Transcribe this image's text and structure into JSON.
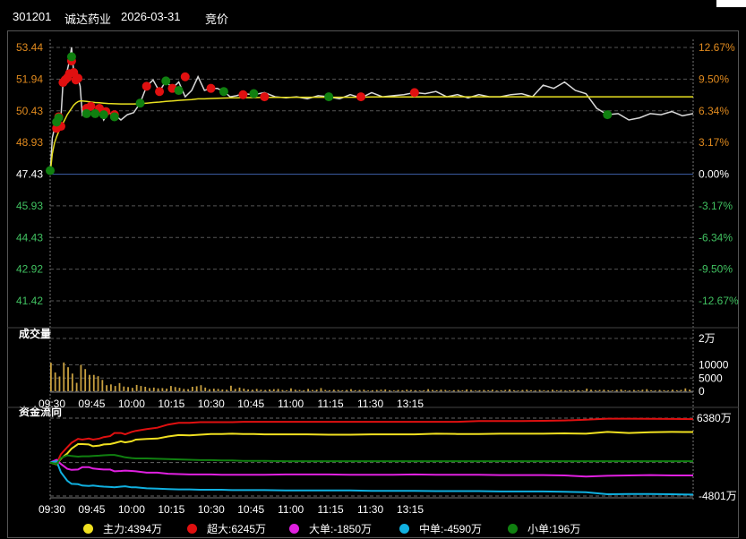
{
  "header": {
    "code": "301201",
    "name": "诚达药业",
    "date": "2026-03-31",
    "mode": "竞价"
  },
  "colors": {
    "up": "#e08a1e",
    "down": "#40c060",
    "price_line": "#d8d8d8",
    "avg_line": "#e8e020",
    "buy_dot": "#e01010",
    "sell_dot": "#108010",
    "volume": "#c8a040",
    "zero_line": "#3a5aa0"
  },
  "chart_data": [
    {
      "type": "line",
      "panel": "price",
      "title": "",
      "base_price": 47.43,
      "ylim": [
        41.42,
        53.44
      ],
      "left_ticks": [
        "53.44",
        "51.94",
        "50.43",
        "48.93",
        "47.43",
        "45.93",
        "44.43",
        "42.92",
        "41.42"
      ],
      "right_ticks": [
        "12.67%",
        "9.50%",
        "6.34%",
        "3.17%",
        "0.00%",
        "-3.17%",
        "-6.34%",
        "-9.50%",
        "-12.67%"
      ],
      "x_minutes": [
        0,
        1,
        2,
        3,
        4,
        5,
        6,
        7,
        8,
        9,
        10,
        11,
        12,
        13,
        14,
        15,
        17,
        19,
        21,
        23,
        25,
        27,
        30,
        33,
        36,
        39,
        42,
        45,
        48,
        51,
        54,
        57,
        60,
        63,
        66,
        69,
        72,
        75,
        78,
        81,
        84,
        87,
        90,
        95,
        100,
        105,
        110,
        115,
        120,
        125,
        130,
        135,
        140,
        145,
        150,
        155,
        160,
        165,
        170,
        175,
        180,
        185,
        190,
        195,
        200,
        205,
        210,
        215,
        220,
        225,
        230,
        235,
        240,
        245,
        250,
        255,
        260,
        265,
        270,
        275,
        280,
        285,
        290,
        295,
        300
      ],
      "series": [
        {
          "values": [
            47.43,
            49.15,
            49.6,
            49.7,
            50.15,
            50.1,
            51.78,
            51.9,
            52.35,
            52.8,
            53.44,
            52.25,
            51.9,
            51.98,
            51.6,
            50.25,
            50.55,
            50.65,
            50.3,
            50.55,
            50.0,
            50.35,
            50.25,
            50.0,
            50.25,
            50.35,
            50.8,
            51.6,
            51.9,
            51.35,
            51.85,
            51.5,
            51.8,
            51.1,
            51.4,
            52.05,
            51.4,
            51.5,
            51.5,
            51.35,
            51.1,
            51.15,
            51.25,
            51.2,
            51.3,
            51.1,
            51.05,
            51.1,
            51.0,
            51.15,
            51.1,
            51.0,
            51.2,
            51.05,
            51.3,
            51.1,
            51.15,
            51.2,
            51.3,
            51.25,
            51.35,
            51.1,
            51.2,
            51.05,
            51.2,
            51.1,
            51.1,
            51.2,
            51.25,
            51.1,
            51.65,
            51.5,
            51.8,
            51.4,
            51.25,
            50.55,
            50.25,
            50.3,
            50.0,
            50.1,
            50.3,
            50.25,
            50.4,
            50.2,
            50.3
          ]
        },
        {
          "values": [
            47.43,
            48.4,
            48.9,
            49.2,
            49.45,
            49.65,
            49.85,
            50.05,
            50.25,
            50.4,
            50.55,
            50.7,
            50.8,
            50.87,
            50.9,
            50.9,
            50.88,
            50.85,
            50.83,
            50.82,
            50.8,
            50.78,
            50.77,
            50.76,
            50.76,
            50.76,
            50.77,
            50.8,
            50.83,
            50.85,
            50.88,
            50.9,
            50.93,
            50.95,
            50.97,
            51.0,
            51.0,
            51.02,
            51.03,
            51.04,
            51.05,
            51.05,
            51.06,
            51.06,
            51.07,
            51.07,
            51.07,
            51.08,
            51.08,
            51.08,
            51.08,
            51.08,
            51.08,
            51.08,
            51.09,
            51.09,
            51.09,
            51.09,
            51.09,
            51.1,
            51.1,
            51.1,
            51.1,
            51.1,
            51.1,
            51.1,
            51.1,
            51.1,
            51.1,
            51.1,
            51.1,
            51.1,
            51.1,
            51.1,
            51.1,
            51.1,
            51.1,
            51.1,
            51.1,
            51.1,
            51.1,
            51.1,
            51.1,
            51.1,
            51.1
          ]
        }
      ],
      "buy_points": [
        [
          3,
          49.6
        ],
        [
          4,
          50.15
        ],
        [
          5,
          49.7
        ],
        [
          6,
          51.78
        ],
        [
          7,
          51.9
        ],
        [
          8,
          52.0
        ],
        [
          9,
          52.2
        ],
        [
          10,
          52.8
        ],
        [
          11,
          52.25
        ],
        [
          12,
          51.9
        ],
        [
          13,
          51.98
        ],
        [
          17,
          50.55
        ],
        [
          19,
          50.65
        ],
        [
          23,
          50.55
        ],
        [
          26,
          50.4
        ],
        [
          30,
          50.25
        ],
        [
          45,
          51.6
        ],
        [
          51,
          51.35
        ],
        [
          57,
          51.5
        ],
        [
          63,
          52.05
        ],
        [
          75,
          51.5
        ],
        [
          90,
          51.2
        ],
        [
          100,
          51.1
        ],
        [
          145,
          51.1
        ],
        [
          170,
          51.3
        ]
      ],
      "sell_points": [
        [
          0,
          47.6
        ],
        [
          3,
          49.9
        ],
        [
          4,
          50.1
        ],
        [
          10,
          53.0
        ],
        [
          17,
          50.3
        ],
        [
          21,
          50.3
        ],
        [
          25,
          50.25
        ],
        [
          30,
          50.15
        ],
        [
          42,
          50.8
        ],
        [
          54,
          51.85
        ],
        [
          60,
          51.4
        ],
        [
          81,
          51.35
        ],
        [
          95,
          51.25
        ],
        [
          130,
          51.1
        ],
        [
          260,
          50.25
        ]
      ]
    },
    {
      "type": "bar",
      "panel": "volume",
      "title": "成交量",
      "yticks": [
        "2万",
        "10000",
        "5000",
        "0"
      ],
      "ylim": [
        0,
        20000
      ],
      "x_minutes": [
        0,
        2,
        4,
        6,
        8,
        10,
        12,
        14,
        16,
        18,
        20,
        22,
        24,
        26,
        28,
        30,
        32,
        34,
        36,
        38,
        40,
        42,
        44,
        46,
        48,
        50,
        52,
        54,
        56,
        58,
        60,
        62,
        64,
        66,
        68,
        70,
        72,
        74,
        76,
        78,
        80,
        82,
        84,
        86,
        88,
        90,
        92,
        94,
        96,
        98,
        100,
        102,
        104,
        106,
        108,
        110,
        112,
        114,
        116,
        118,
        120,
        122,
        124,
        126,
        128,
        130,
        132,
        134,
        136,
        138,
        140,
        142,
        144,
        146,
        148,
        150,
        152,
        154,
        156,
        158,
        160,
        162,
        164,
        166,
        168,
        170,
        172,
        174,
        176,
        178,
        180,
        182,
        184,
        186,
        188,
        190,
        192,
        194,
        196,
        198,
        200,
        202,
        204,
        206,
        208,
        210,
        212,
        214,
        216,
        218,
        220,
        222,
        224,
        226,
        228,
        230,
        232,
        234,
        236,
        238,
        240,
        242,
        244,
        246,
        248,
        250,
        252,
        254,
        256,
        258,
        260,
        262,
        264,
        266,
        268,
        270,
        272,
        274,
        276,
        278,
        280,
        282,
        284,
        286,
        288,
        290,
        292,
        294,
        296,
        298,
        300
      ],
      "values": [
        10800,
        7100,
        5600,
        10900,
        9100,
        6700,
        3200,
        10000,
        8400,
        6200,
        6200,
        5700,
        4300,
        2300,
        2600,
        2000,
        3100,
        1800,
        1600,
        1300,
        2400,
        2000,
        1700,
        1200,
        1400,
        1100,
        1200,
        1000,
        2000,
        1600,
        1300,
        900,
        800,
        1700,
        1900,
        2300,
        1400,
        800,
        1000,
        900,
        700,
        600,
        2100,
        900,
        1400,
        1000,
        700,
        600,
        900,
        600,
        500,
        700,
        800,
        900,
        500,
        400,
        1100,
        600,
        500,
        400,
        900,
        500,
        600,
        1200,
        500,
        400,
        600,
        500,
        400,
        500,
        800,
        400,
        500,
        600,
        300,
        400,
        500,
        600,
        700,
        400,
        300,
        500,
        400,
        600,
        500,
        400,
        300,
        400,
        800,
        500,
        400,
        600,
        500,
        300,
        400,
        500,
        400,
        700,
        500,
        300,
        400,
        500,
        400,
        600,
        300,
        400,
        500,
        700,
        400,
        300,
        500,
        600,
        400,
        300,
        500,
        400,
        300,
        600,
        400,
        500,
        300,
        400,
        500,
        400,
        300,
        1000,
        600,
        400,
        500,
        600,
        400,
        300,
        500,
        700,
        400,
        300,
        500,
        400,
        600,
        800,
        400,
        300,
        500,
        400,
        300,
        600,
        400,
        500,
        1100,
        600
      ]
    },
    {
      "type": "line",
      "panel": "fund_flow",
      "title": "资金流向",
      "yticks": [
        "6380万",
        "-4801万"
      ],
      "ylim": [
        -4801,
        6380
      ],
      "x_minutes": [
        0,
        3,
        5,
        8,
        10,
        13,
        15,
        18,
        20,
        23,
        25,
        28,
        30,
        33,
        35,
        38,
        40,
        45,
        50,
        55,
        60,
        65,
        70,
        75,
        80,
        85,
        90,
        95,
        100,
        110,
        120,
        130,
        140,
        150,
        160,
        170,
        180,
        190,
        200,
        210,
        220,
        230,
        240,
        250,
        260,
        270,
        280,
        290,
        300
      ],
      "series": [
        {
          "name": "主力",
          "color": "#f0e020",
          "values": [
            0,
            -250,
            550,
            1300,
            2000,
            2650,
            2650,
            2600,
            2350,
            2450,
            2600,
            2650,
            2800,
            3050,
            2900,
            3050,
            3300,
            3400,
            3450,
            3750,
            3950,
            3900,
            4000,
            4100,
            4100,
            4150,
            4100,
            4100,
            4050,
            4050,
            4050,
            4000,
            4000,
            4050,
            4050,
            4050,
            4150,
            4100,
            4100,
            4150,
            4150,
            4150,
            4200,
            4150,
            4400,
            4250,
            4350,
            4400,
            4394
          ]
        },
        {
          "name": "超大",
          "color": "#e01010",
          "values": [
            0,
            -100,
            1200,
            2200,
            2850,
            3400,
            3300,
            3450,
            3300,
            3450,
            3650,
            3800,
            4250,
            4250,
            4050,
            4400,
            4550,
            4800,
            5000,
            5450,
            5700,
            5700,
            5800,
            5800,
            5800,
            5800,
            5850,
            5850,
            5850,
            5850,
            5850,
            5850,
            5850,
            5850,
            5850,
            5850,
            5850,
            5850,
            5950,
            5950,
            5950,
            6000,
            6050,
            6150,
            6300,
            6300,
            6280,
            6260,
            6245
          ]
        },
        {
          "name": "大单",
          "color": "#e020e0",
          "values": [
            0,
            400,
            -200,
            -900,
            -1050,
            -1000,
            -650,
            -650,
            -850,
            -950,
            -1000,
            -1000,
            -1250,
            -1200,
            -1150,
            -1200,
            -1250,
            -1450,
            -1450,
            -1600,
            -1650,
            -1700,
            -1700,
            -1700,
            -1750,
            -1750,
            -1750,
            -1750,
            -1750,
            -1700,
            -1700,
            -1700,
            -1750,
            -1750,
            -1750,
            -1700,
            -1750,
            -1750,
            -1750,
            -1800,
            -1800,
            -1800,
            -1850,
            -2000,
            -1900,
            -1850,
            -1800,
            -1850,
            -1850
          ]
        },
        {
          "name": "中单",
          "color": "#10b0e0",
          "values": [
            0,
            200,
            -1400,
            -2600,
            -3050,
            -3100,
            -3300,
            -3350,
            -3300,
            -3400,
            -3450,
            -3500,
            -3550,
            -3450,
            -3400,
            -3550,
            -3550,
            -3700,
            -3750,
            -3800,
            -3850,
            -3850,
            -3900,
            -3900,
            -3900,
            -3950,
            -3950,
            -3950,
            -3950,
            -4000,
            -4000,
            -4000,
            -4000,
            -4050,
            -4050,
            -4050,
            -4100,
            -4100,
            -4100,
            -4150,
            -4150,
            -4150,
            -4200,
            -4250,
            -4550,
            -4500,
            -4500,
            -4550,
            -4590
          ]
        },
        {
          "name": "小单",
          "color": "#108010",
          "values": [
            0,
            -200,
            650,
            1050,
            950,
            850,
            900,
            900,
            950,
            1000,
            1050,
            1100,
            1100,
            900,
            750,
            650,
            600,
            600,
            550,
            500,
            450,
            400,
            350,
            350,
            300,
            300,
            250,
            250,
            250,
            200,
            200,
            200,
            200,
            200,
            200,
            200,
            200,
            200,
            200,
            200,
            200,
            200,
            200,
            200,
            200,
            200,
            200,
            200,
            196
          ]
        }
      ]
    }
  ],
  "time_axis": [
    "09:30",
    "09:45",
    "10:00",
    "10:15",
    "10:30",
    "10:45",
    "11:00",
    "11:15",
    "11:30",
    "13:15"
  ],
  "legend": [
    {
      "label": "主力:4394万",
      "color": "#f0e020"
    },
    {
      "label": "超大:6245万",
      "color": "#e01010"
    },
    {
      "label": "大单:-1850万",
      "color": "#e020e0"
    },
    {
      "label": "中单:-4590万",
      "color": "#10b0e0"
    },
    {
      "label": "小单:196万",
      "color": "#108010"
    }
  ]
}
